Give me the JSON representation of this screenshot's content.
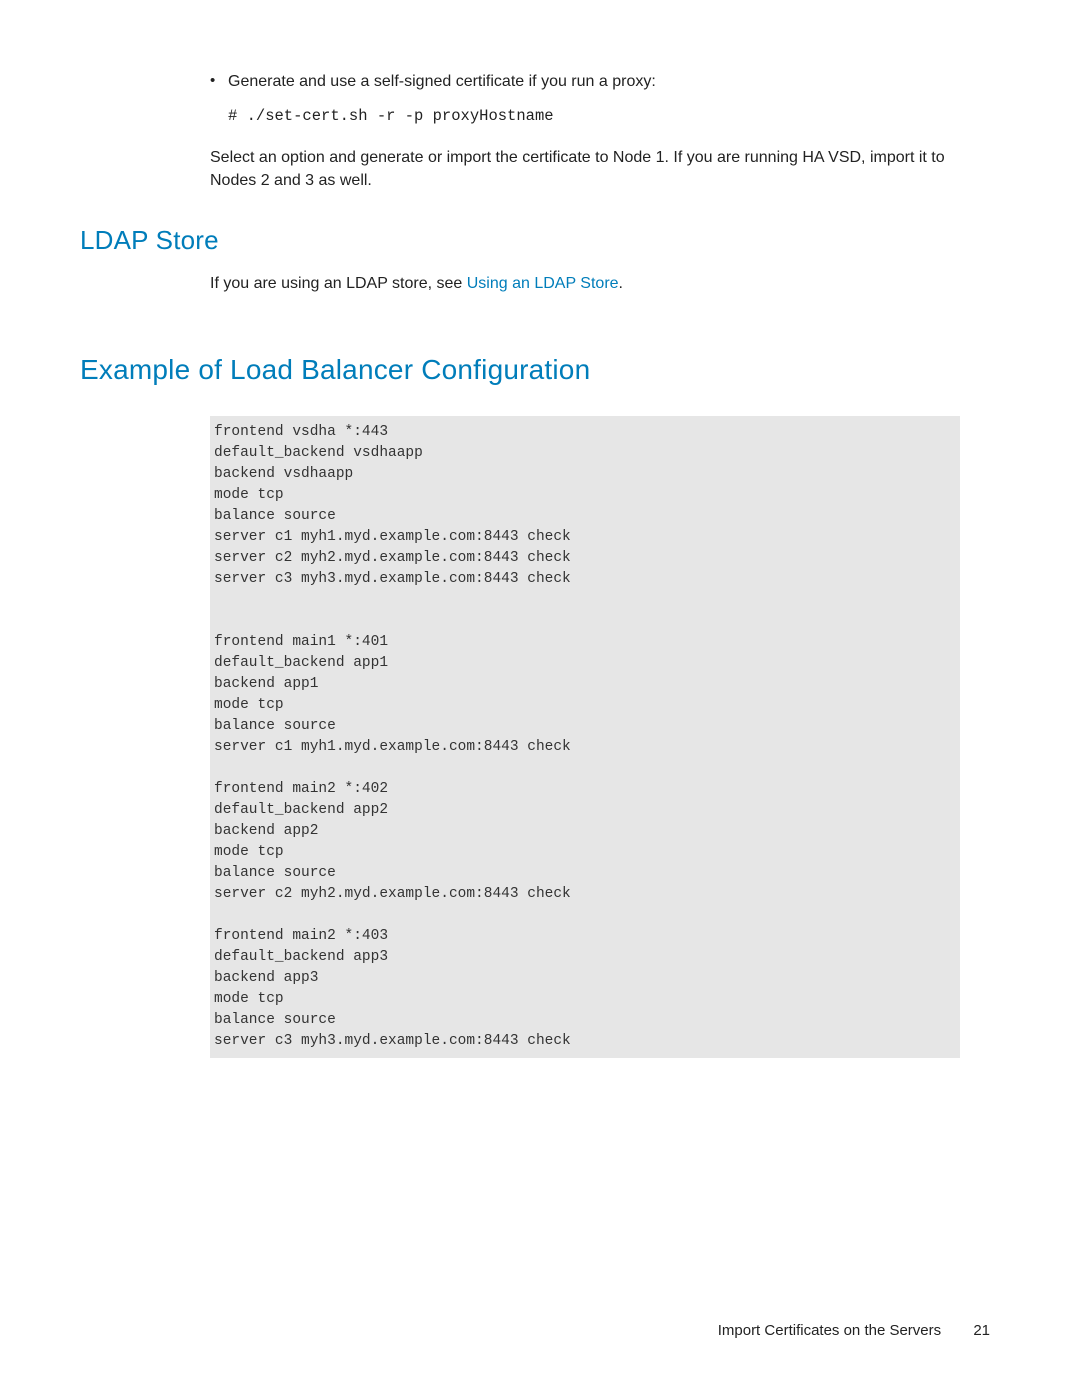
{
  "bullet": {
    "text": "Generate and use a self-signed certificate if you run a proxy:"
  },
  "command": "# ./set-cert.sh -r -p proxyHostname",
  "para_select": "Select an option and generate or import the certificate to Node 1. If you are running HA VSD, import it to Nodes 2 and 3 as well.",
  "ldap": {
    "heading": "LDAP Store",
    "text_prefix": "If you are using an LDAP store, see ",
    "link": "Using an LDAP Store",
    "text_suffix": "."
  },
  "lb": {
    "heading": "Example of Load Balancer Configuration",
    "code": "frontend vsdha *:443\ndefault_backend vsdhaapp\nbackend vsdhaapp\nmode tcp\nbalance source\nserver c1 myh1.myd.example.com:8443 check\nserver c2 myh2.myd.example.com:8443 check\nserver c3 myh3.myd.example.com:8443 check\n\n\nfrontend main1 *:401\ndefault_backend app1\nbackend app1\nmode tcp\nbalance source\nserver c1 myh1.myd.example.com:8443 check\n\nfrontend main2 *:402\ndefault_backend app2\nbackend app2\nmode tcp\nbalance source\nserver c2 myh2.myd.example.com:8443 check\n\nfrontend main2 *:403\ndefault_backend app3\nbackend app3\nmode tcp\nbalance source\nserver c3 myh3.myd.example.com:8443 check"
  },
  "footer": {
    "section": "Import Certificates on the Servers",
    "page": "21"
  }
}
